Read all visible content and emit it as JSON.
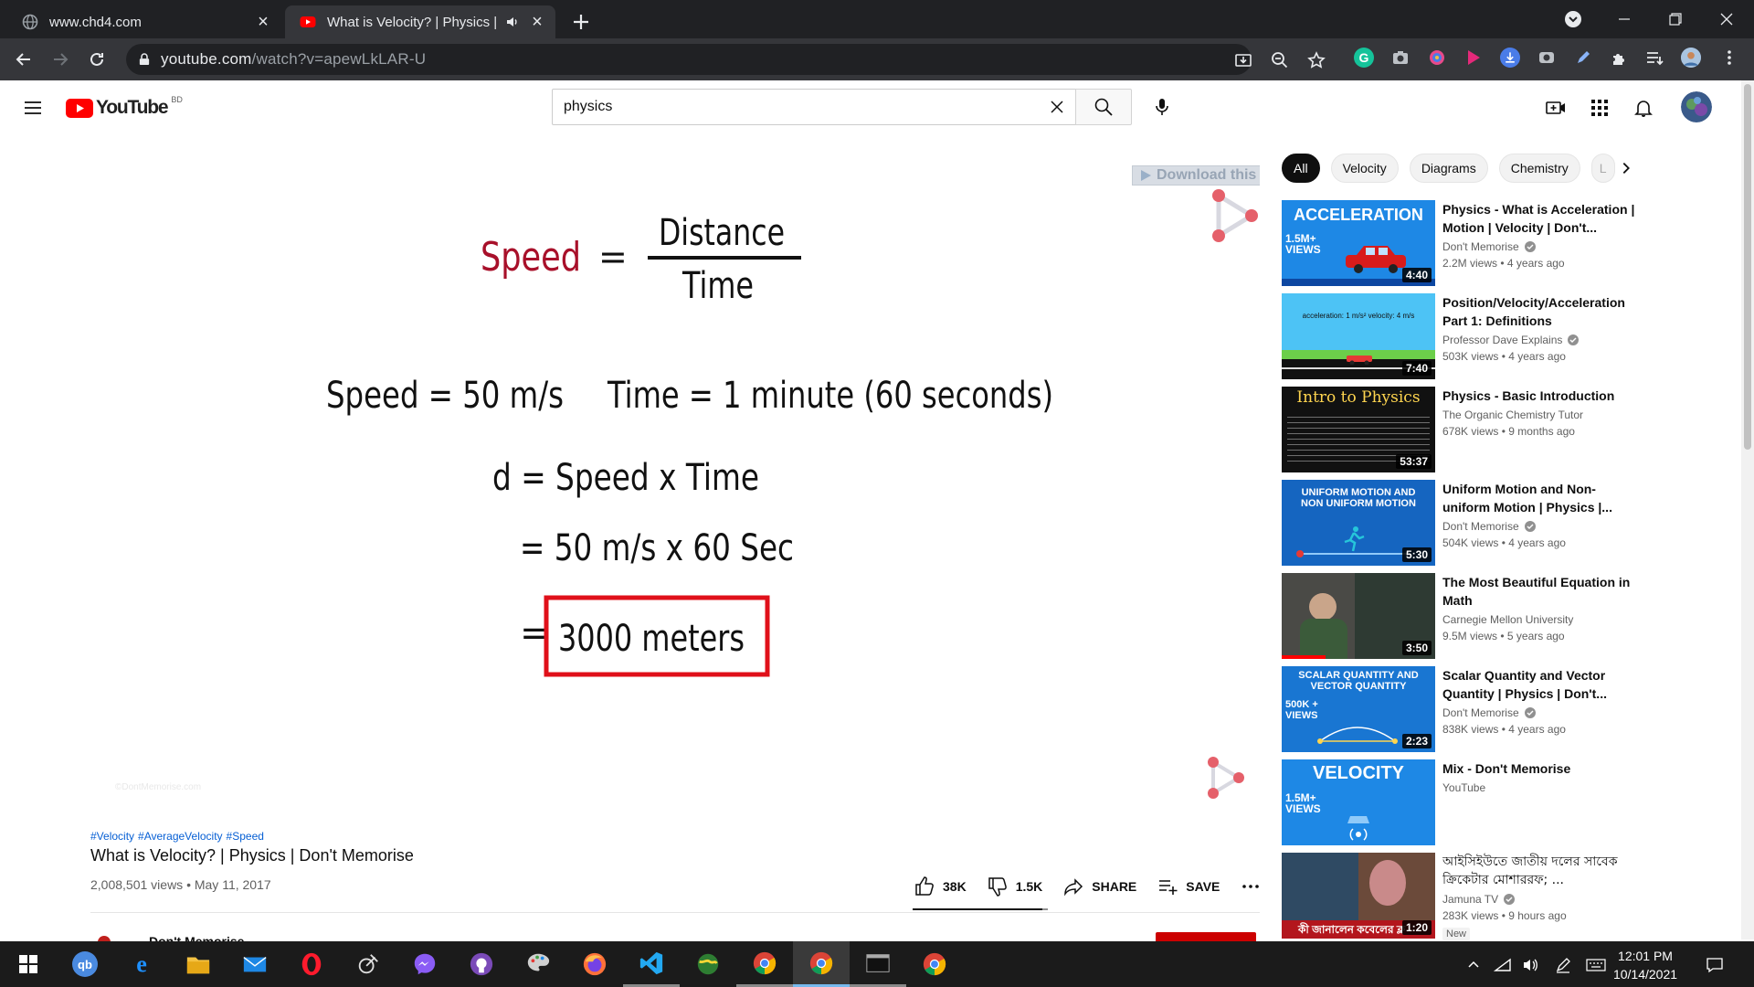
{
  "browser": {
    "tabs": [
      {
        "title": "www.chd4.com",
        "close": "×",
        "active": false
      },
      {
        "title": "What is Velocity? | Physics | Don't Memorise - YouTube",
        "close": "×",
        "active": true
      }
    ],
    "new_tab": "+",
    "url_host": "youtube.com",
    "url_path": "/watch?v=apewLkLAR-U"
  },
  "youtube": {
    "logo_text": "YouTube",
    "region": "BD",
    "search_value": "physics",
    "player": {
      "download_banner": "Download this video",
      "download_help": "?",
      "download_close": "×",
      "slide": {
        "speed": "Speed",
        "eq": "=",
        "distance": "Distance",
        "time": "Time",
        "line2_speed": "Speed  =  50 m/s",
        "line2_time": "Time  = 1 minute (60 seconds)",
        "line3": "d =  Speed x Time",
        "line4": "=  50 m/s x 60 Sec",
        "line5_eq": "=",
        "answer": "3000 meters"
      },
      "watermark": "©DontMemorise.com"
    },
    "hashtags": [
      "#Velocity",
      "#AverageVelocity",
      "#Speed"
    ],
    "video_title": "What is Velocity? | Physics | Don't Memorise",
    "video_meta": "2,008,501 views • May 11, 2017",
    "actions": {
      "likes": "38K",
      "dislikes": "1.5K",
      "share": "SHARE",
      "save": "SAVE",
      "like_ratio": 0.962
    },
    "channel_name": "Don't Memorise",
    "chips": [
      "All",
      "Velocity",
      "Diagrams",
      "Chemistry",
      "L"
    ],
    "recommendations": [
      {
        "title": "Physics - What is Acceleration | Motion | Velocity | Don't...",
        "channel": "Don't Memorise",
        "verified": true,
        "stats": "2.2M views • 4 years ago",
        "duration": "4:40",
        "thumb_text": "ACCELERATION",
        "thumb_badge": "1.5M+\nVIEWS",
        "thumb_bg": "#1e88e5"
      },
      {
        "title": "Position/Velocity/Acceleration Part 1: Definitions",
        "channel": "Professor Dave Explains",
        "verified": true,
        "stats": "503K views • 4 years ago",
        "duration": "7:40",
        "thumb_text": "acceleration: 1 m/s²   velocity: 4 m/s",
        "thumb_bg": "#4dc3f5"
      },
      {
        "title": "Physics - Basic Introduction",
        "channel": "The Organic Chemistry Tutor",
        "verified": false,
        "stats": "678K views • 9 months ago",
        "duration": "53:37",
        "thumb_text": "Intro to Physics",
        "thumb_bg": "#111111"
      },
      {
        "title": "Uniform Motion and Non-uniform Motion | Physics |...",
        "channel": "Don't Memorise",
        "verified": true,
        "stats": "504K views • 4 years ago",
        "duration": "5:30",
        "thumb_text": "UNIFORM MOTION AND NON UNIFORM MOTION",
        "thumb_bg": "#1565c0"
      },
      {
        "title": "The Most Beautiful Equation in Math",
        "channel": "Carnegie Mellon University",
        "verified": false,
        "stats": "9.5M views • 5 years ago",
        "duration": "3:50",
        "thumb_text": "",
        "thumb_bg": "#4a4a46"
      },
      {
        "title": "Scalar Quantity and Vector Quantity | Physics | Don't...",
        "channel": "Don't Memorise",
        "verified": true,
        "stats": "838K views • 4 years ago",
        "duration": "2:23",
        "thumb_text": "SCALAR QUANTITY AND VECTOR QUANTITY",
        "thumb_badge": "500K +\nVIEWS",
        "thumb_bg": "#1976d2"
      },
      {
        "title": "Mix - Don't Memorise",
        "channel": "YouTube",
        "verified": false,
        "stats": "",
        "duration": "",
        "thumb_text": "VELOCITY",
        "thumb_badge": "1.5M+\nVIEWS",
        "thumb_bg": "#1e88e5"
      },
      {
        "title": "আইসিইউতে জাতীয় দলের সাবেক ক্রিকেটার মোশাররফ; ...",
        "channel": "Jamuna TV",
        "verified": true,
        "stats": "283K views • 9 hours ago",
        "duration": "1:20",
        "thumb_text": "কী জানালেন কবেলের ক্ল",
        "thumb_bg": "#6b4a3a",
        "badge": "New"
      }
    ]
  },
  "taskbar": {
    "time": "12:01 PM",
    "date": "10/14/2021"
  },
  "colors": {
    "yt_red": "#ff0000",
    "speed_red": "#a8102a",
    "answer_box": "#e0101a",
    "chrome_dark": "#202124",
    "chrome_toolbar": "#35363a",
    "link_blue": "#065fd4"
  }
}
